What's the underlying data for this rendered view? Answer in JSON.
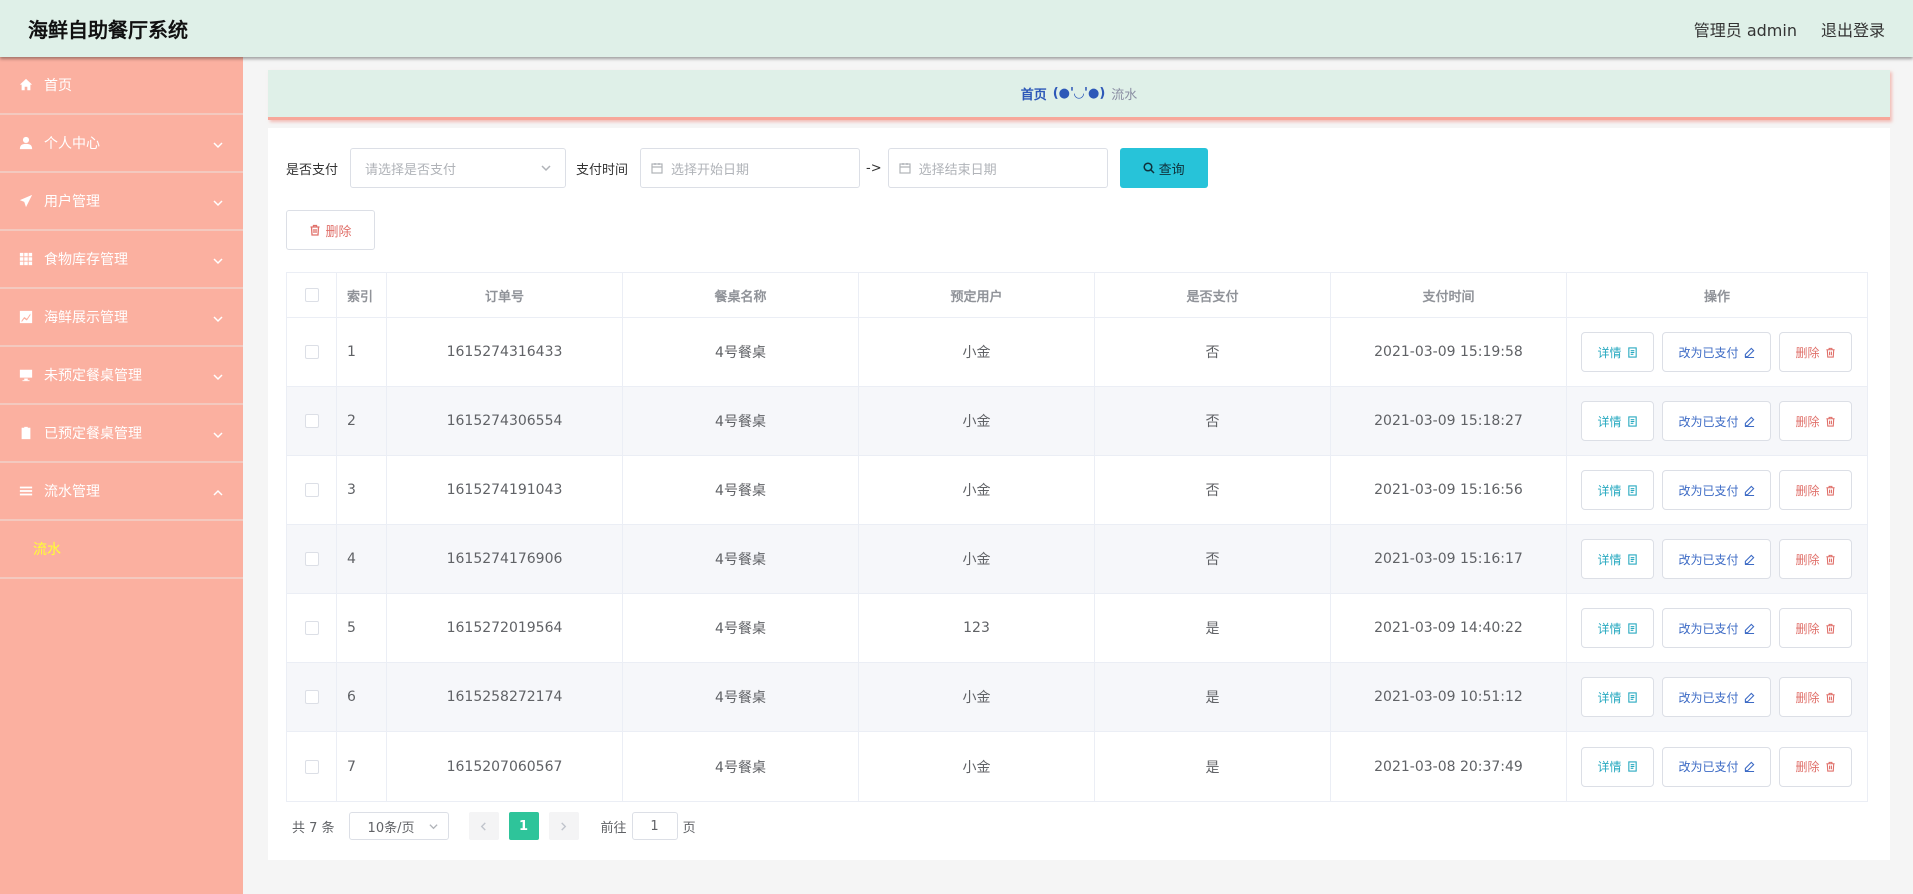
{
  "header": {
    "title": "海鲜自助餐厅系统",
    "user_label": "管理员 admin",
    "logout_label": "退出登录"
  },
  "sidebar": {
    "items": [
      {
        "label": "首页",
        "icon": "home-icon",
        "has_children": false
      },
      {
        "label": "个人中心",
        "icon": "user-icon",
        "has_children": true
      },
      {
        "label": "用户管理",
        "icon": "paper-plane-icon",
        "has_children": true
      },
      {
        "label": "食物库存管理",
        "icon": "grid-icon",
        "has_children": true
      },
      {
        "label": "海鲜展示管理",
        "icon": "chart-icon",
        "has_children": true
      },
      {
        "label": "未预定餐桌管理",
        "icon": "monitor-icon",
        "has_children": true
      },
      {
        "label": "已预定餐桌管理",
        "icon": "clipboard-icon",
        "has_children": true
      },
      {
        "label": "流水管理",
        "icon": "menu-lines-icon",
        "has_children": true,
        "expanded": true
      }
    ],
    "submenu": {
      "label": "流水"
    }
  },
  "breadcrumb": {
    "home": "首页",
    "separator": "(●'◡'●)",
    "current": "流水"
  },
  "filters": {
    "paid_label": "是否支付",
    "paid_placeholder": "请选择是否支付",
    "time_label": "支付时间",
    "start_placeholder": "选择开始日期",
    "range_sep": "->",
    "end_placeholder": "选择结束日期",
    "search_label": "查询"
  },
  "bulk_delete_label": "删除",
  "table": {
    "headers": {
      "index": "索引",
      "order_no": "订单号",
      "table_name": "餐桌名称",
      "user": "预定用户",
      "paid": "是否支付",
      "pay_time": "支付时间",
      "ops": "操作"
    },
    "rows": [
      {
        "index": "1",
        "order_no": "1615274316433",
        "table_name": "4号餐桌",
        "user": "小金",
        "paid": "否",
        "pay_time": "2021-03-09 15:19:58"
      },
      {
        "index": "2",
        "order_no": "1615274306554",
        "table_name": "4号餐桌",
        "user": "小金",
        "paid": "否",
        "pay_time": "2021-03-09 15:18:27"
      },
      {
        "index": "3",
        "order_no": "1615274191043",
        "table_name": "4号餐桌",
        "user": "小金",
        "paid": "否",
        "pay_time": "2021-03-09 15:16:56"
      },
      {
        "index": "4",
        "order_no": "1615274176906",
        "table_name": "4号餐桌",
        "user": "小金",
        "paid": "否",
        "pay_time": "2021-03-09 15:16:17"
      },
      {
        "index": "5",
        "order_no": "1615272019564",
        "table_name": "4号餐桌",
        "user": "123",
        "paid": "是",
        "pay_time": "2021-03-09 14:40:22"
      },
      {
        "index": "6",
        "order_no": "1615258272174",
        "table_name": "4号餐桌",
        "user": "小金",
        "paid": "是",
        "pay_time": "2021-03-09 10:51:12"
      },
      {
        "index": "7",
        "order_no": "1615207060567",
        "table_name": "4号餐桌",
        "user": "小金",
        "paid": "是",
        "pay_time": "2021-03-08 20:37:49"
      }
    ],
    "ops": {
      "detail": "详情",
      "mark_paid": "改为已支付",
      "delete": "删除"
    }
  },
  "pagination": {
    "total": "共 7 条",
    "page_size": "10条/页",
    "current_page": "1",
    "goto_prefix": "前往",
    "goto_value": "1",
    "goto_suffix": "页"
  },
  "colors": {
    "header_bg": "#dff0e8",
    "sidebar_bg": "#fbb0a0",
    "submenu_active": "#ffff33",
    "search_btn": "#27c3d9",
    "page_active": "#2ec49a",
    "danger": "#e0706a"
  }
}
